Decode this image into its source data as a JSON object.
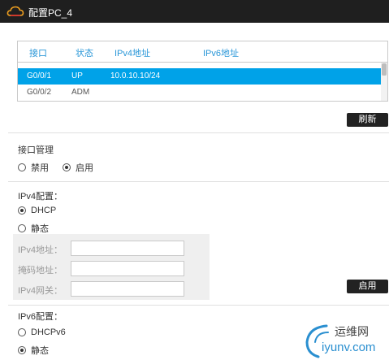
{
  "window": {
    "title": "配置PC_4"
  },
  "interfaces_table": {
    "headers": [
      "接口",
      "状态",
      "IPv4地址",
      "IPv6地址"
    ],
    "rows": [
      [
        "G0/0/1",
        "UP",
        "10.0.10.10/24",
        ""
      ],
      [
        "G0/0/2",
        "ADM",
        "",
        ""
      ]
    ],
    "selected_row": 0
  },
  "refresh_button": "刷新",
  "interface_mgmt": {
    "title": "接口管理",
    "options": [
      {
        "label": "禁用",
        "checked": false
      },
      {
        "label": "启用",
        "checked": true
      }
    ]
  },
  "ipv4": {
    "title": "IPv4配置：",
    "options": [
      {
        "label": "DHCP",
        "checked": true
      },
      {
        "label": "静态",
        "checked": false
      }
    ],
    "fields": [
      {
        "label": "IPv4地址：",
        "value": ""
      },
      {
        "label": "掩码地址：",
        "value": ""
      },
      {
        "label": "IPv4网关：",
        "value": ""
      }
    ],
    "apply_button": "启用"
  },
  "ipv6": {
    "title": "IPv6配置：",
    "options": [
      {
        "label": "DHCPv6",
        "checked": false
      },
      {
        "label": "静态",
        "checked": true
      }
    ]
  },
  "watermark": {
    "line1": "运维网",
    "line2": "iyunv.com"
  },
  "colors": {
    "accent": "#00a2e8",
    "header_text": "#2a97d8",
    "titlebar": "#1f1f1f"
  }
}
